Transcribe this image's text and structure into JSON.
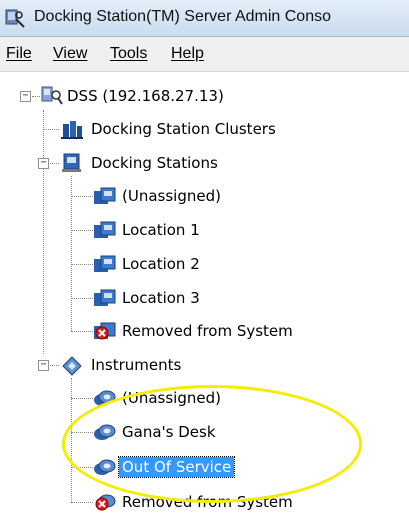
{
  "window": {
    "title": "Docking Station(TM) Server Admin Conso"
  },
  "menu": {
    "file": "File",
    "view": "View",
    "tools": "Tools",
    "help": "Help"
  },
  "tree": {
    "root": "DSS (192.168.27.13)",
    "clusters": "Docking Station Clusters",
    "docking_stations": {
      "label": "Docking Stations",
      "children": [
        "(Unassigned)",
        "Location 1",
        "Location 2",
        "Location 3",
        "Removed from System"
      ]
    },
    "instruments": {
      "label": "Instruments",
      "children": [
        "(Unassigned)",
        "Gana's Desk",
        "Out Of Service",
        "Removed from System"
      ],
      "selected": "Out Of Service"
    }
  },
  "colors": {
    "selection": "#3399ff",
    "annotation_highlight": "#f5ec00"
  }
}
